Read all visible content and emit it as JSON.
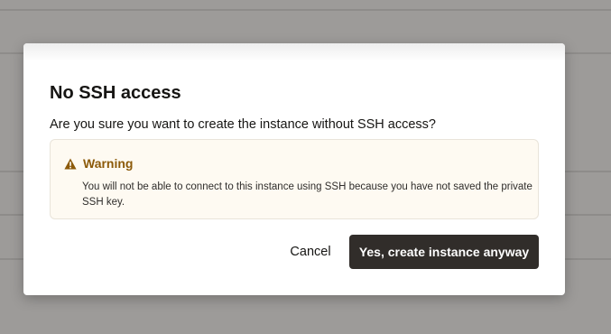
{
  "dialog": {
    "title": "No SSH access",
    "question": "Are you sure you want to create the instance without SSH access?",
    "warning": {
      "icon": "warning-triangle-icon",
      "title": "Warning",
      "text": "You will not be able to connect to this instance using SSH because you have not saved the private SSH key."
    },
    "actions": {
      "cancel_label": "Cancel",
      "confirm_label": "Yes, create instance anyway"
    }
  },
  "colors": {
    "backdrop": "#9d9b99",
    "primary_button": "#312d2a",
    "warning_accent": "#8c5a0a",
    "warning_background": "#fefaf2"
  }
}
